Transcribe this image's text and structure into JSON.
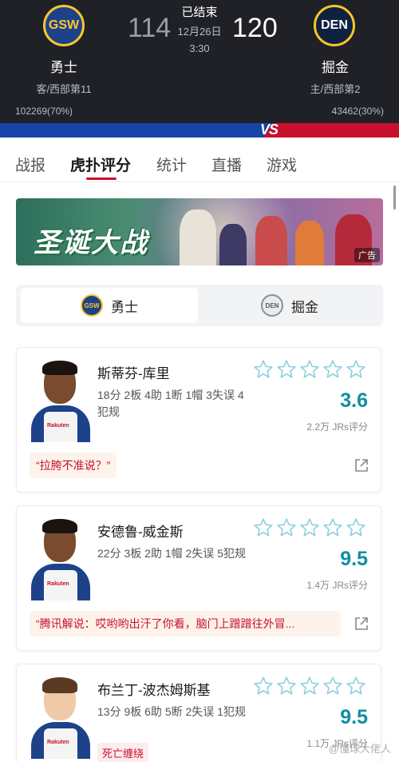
{
  "game": {
    "status": "已结束",
    "date": "12月26日",
    "time": "3:30",
    "home": {
      "abbr": "GSW",
      "name": "勇士",
      "rank": "客/西部第11",
      "score": "114",
      "votes": "102269(70%)",
      "color": "#1d428a"
    },
    "away": {
      "abbr": "DEN",
      "name": "掘金",
      "rank": "主/西部第2",
      "score": "120",
      "votes": "43462(30%)",
      "color": "#0e2240"
    },
    "vs": "VS"
  },
  "tabs": [
    "战报",
    "虎扑评分",
    "统计",
    "直播",
    "游戏"
  ],
  "active_tab": "虎扑评分",
  "banner": {
    "title": "圣诞大战",
    "ad_label": "广告"
  },
  "team_switch": {
    "left": {
      "abbr": "GSW",
      "label": "勇士"
    },
    "right": {
      "abbr": "DEN",
      "label": "掘金"
    },
    "selected": "勇士"
  },
  "players": [
    {
      "name": "斯蒂芬-库里",
      "stats": "18分 2板 4助 1断 1帽 3失误 4犯规",
      "score": "3.6",
      "rating_count": "2.2万 JRs评分",
      "comment": "“拉胯不准说？”",
      "jersey": "Rakuten"
    },
    {
      "name": "安德鲁-威金斯",
      "stats": "22分 3板 2助 1帽 2失误 5犯规",
      "score": "9.5",
      "rating_count": "1.4万 JRs评分",
      "comment": "“腾讯解说：哎哟哟出汗了你看，脑门上蹭蹭往外冒...",
      "jersey": "Rakuten"
    },
    {
      "name": "布兰丁-波杰姆斯基",
      "stats": "13分 9板 6助 5断 2失误 1犯规",
      "score": "9.5",
      "rating_count": "1.1万 JRs评分",
      "tag": "死亡缠绕",
      "jersey": "Rakuten"
    }
  ],
  "watermark": "@懂球大佬人"
}
